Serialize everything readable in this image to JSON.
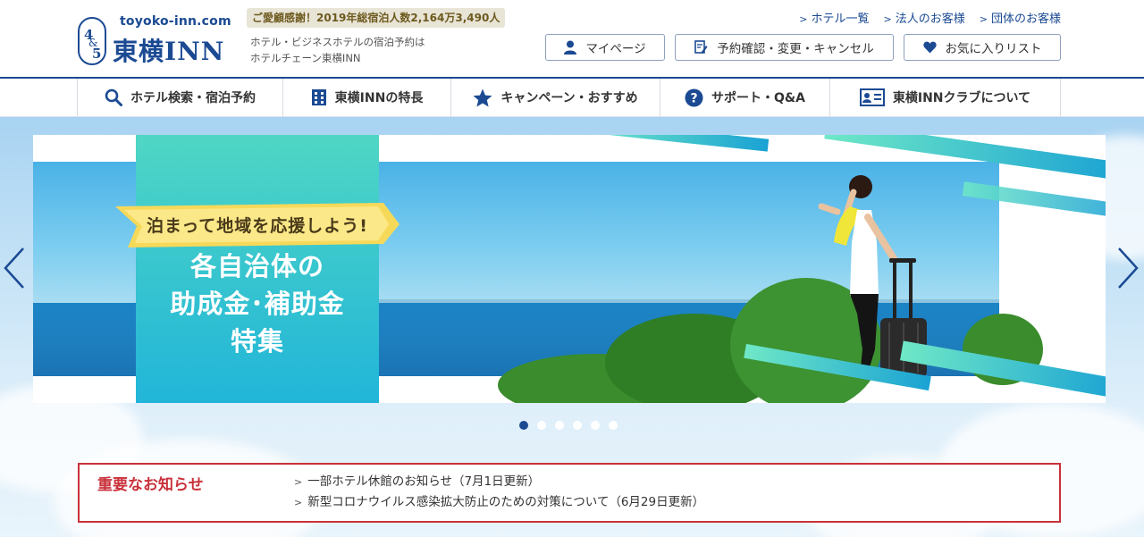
{
  "header": {
    "logo_domain": "toyoko-inn.com",
    "logo_name": "東横INN",
    "logo_mark": "4&5",
    "thanks_badge": "ご愛顧感謝！2019年総宿泊人数2,164万3,490人",
    "tagline_line1": "ホテル・ビジネスホテルの宿泊予約は",
    "tagline_line2": "ホテルチェーン東横INN",
    "top_links": [
      "ホテル一覧",
      "法人のお客様",
      "団体のお客様"
    ],
    "buttons": {
      "mypage": "マイページ",
      "reserve": "予約確認・変更・キャンセル",
      "favorites": "お気に入りリスト"
    }
  },
  "nav": {
    "items": [
      {
        "label": "ホテル検索・宿泊予約",
        "icon": "search-icon"
      },
      {
        "label": "東横INNの特長",
        "icon": "building-icon"
      },
      {
        "label": "キャンペーン・おすすめ",
        "icon": "star-icon"
      },
      {
        "label": "サポート・Q&A",
        "icon": "help-icon"
      },
      {
        "label": "東横INNクラブについて",
        "icon": "member-card-icon"
      }
    ]
  },
  "hero": {
    "ribbon": "泊まって地域を応援しよう!",
    "title_line1": "各自治体の",
    "title_line2": "助成金･補助金",
    "title_line3": "特集",
    "slide_count": 6,
    "active_slide": 1
  },
  "notice": {
    "title": "重要なお知らせ",
    "items": [
      "一部ホテル休館のお知らせ（7月1日更新）",
      "新型コロナウイルス感染拡大防止のための対策について（6月29日更新）"
    ]
  },
  "colors": {
    "brand_blue": "#1b4a93",
    "notice_red": "#c9313a",
    "teal": "#21b5d9"
  }
}
